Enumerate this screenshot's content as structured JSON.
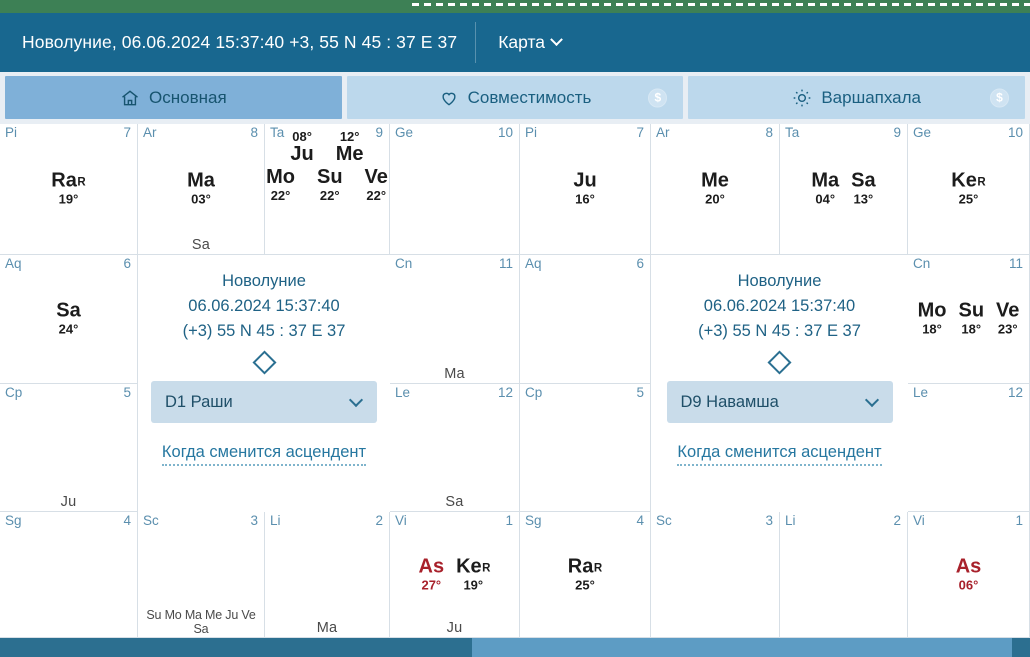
{
  "header": {
    "title": "Новолуние, 06.06.2024 15:37:40 +3, 55 N 45 : 37 E 37",
    "menu_label": "Карта",
    "chevron_icon": "chevron-down-icon",
    "bg": "#18678f"
  },
  "tabs": [
    {
      "label": "Основная",
      "icon": "home-icon",
      "active": true,
      "badge": ""
    },
    {
      "label": "Совместимость",
      "icon": "heart-icon",
      "active": false,
      "badge": "$"
    },
    {
      "label": "Варшапхала",
      "icon": "sun-icon",
      "active": false,
      "badge": "$"
    }
  ],
  "center_panels": {
    "left": {
      "title": "Новолуние",
      "datetime": "06.06.2024 15:37:40",
      "location": "(+3) 55 N 45 : 37 E 37",
      "diamond_icon": "diamond-icon",
      "select_value": "D1 Раши",
      "select_chevron_icon": "chevron-down-icon",
      "link_label": "Когда сменится асцендент"
    },
    "right": {
      "title": "Новолуние",
      "datetime": "06.06.2024 15:37:40",
      "location": "(+3) 55 N 45 : 37 E 37",
      "diamond_icon": "diamond-icon",
      "select_value": "D9 Навамша",
      "select_chevron_icon": "chevron-down-icon",
      "link_label": "Когда сменится асцендент"
    }
  },
  "chart_left": {
    "name": "D1 Раши",
    "cells": [
      {
        "sign": "Pi",
        "house": "7",
        "lord": "",
        "planets": [
          {
            "name": "Ra",
            "deg": "19°",
            "retro": "R",
            "asc": false
          }
        ]
      },
      {
        "sign": "Ar",
        "house": "8",
        "lord": "Sa",
        "planets": [
          {
            "name": "Ma",
            "deg": "03°",
            "retro": "",
            "asc": false
          }
        ]
      },
      {
        "sign": "Ta",
        "house": "9",
        "lord": "",
        "rows": [
          [
            {
              "name": "Ju",
              "deg": "08°",
              "degtop": true,
              "retro": "",
              "asc": false
            },
            {
              "name": "Me",
              "deg": "12°",
              "degtop": true,
              "retro": "",
              "asc": false
            }
          ],
          [
            {
              "name": "Mo",
              "deg": "22°",
              "retro": "",
              "asc": false
            },
            {
              "name": "Su",
              "deg": "22°",
              "retro": "",
              "asc": false
            },
            {
              "name": "Ve",
              "deg": "22°",
              "retro": "",
              "asc": false
            }
          ]
        ]
      },
      {
        "sign": "Ge",
        "house": "10",
        "lord": "",
        "planets": []
      },
      {
        "sign": "Aq",
        "house": "6",
        "lord": "",
        "planets": [
          {
            "name": "Sa",
            "deg": "24°",
            "retro": "",
            "asc": false
          }
        ]
      },
      {
        "sign": "Cn",
        "house": "11",
        "lord": "Ma",
        "planets": []
      },
      {
        "sign": "Cp",
        "house": "5",
        "lord": "Ju",
        "planets": []
      },
      {
        "sign": "Le",
        "house": "12",
        "lord": "Sa",
        "planets": []
      },
      {
        "sign": "Sg",
        "house": "4",
        "lord": "",
        "planets": []
      },
      {
        "sign": "Sc",
        "house": "3",
        "lord": "Su Mo Ma Me Ju Ve Sa",
        "lord_tight": true,
        "planets": []
      },
      {
        "sign": "Li",
        "house": "2",
        "lord": "Ma",
        "planets": []
      },
      {
        "sign": "Vi",
        "house": "1",
        "lord": "Ju",
        "planets": [
          {
            "name": "As",
            "deg": "27°",
            "retro": "",
            "asc": true
          },
          {
            "name": "Ke",
            "deg": "19°",
            "retro": "R",
            "asc": false
          }
        ]
      }
    ]
  },
  "chart_right": {
    "name": "D9 Навамша",
    "cells": [
      {
        "sign": "Pi",
        "house": "7",
        "lord": "",
        "planets": [
          {
            "name": "Ju",
            "deg": "16°",
            "retro": "",
            "asc": false
          }
        ]
      },
      {
        "sign": "Ar",
        "house": "8",
        "lord": "",
        "planets": [
          {
            "name": "Me",
            "deg": "20°",
            "retro": "",
            "asc": false
          }
        ]
      },
      {
        "sign": "Ta",
        "house": "9",
        "lord": "",
        "planets": [
          {
            "name": "Ma",
            "deg": "04°",
            "retro": "",
            "asc": false
          },
          {
            "name": "Sa",
            "deg": "13°",
            "retro": "",
            "asc": false
          }
        ]
      },
      {
        "sign": "Ge",
        "house": "10",
        "lord": "",
        "planets": [
          {
            "name": "Ke",
            "deg": "25°",
            "retro": "R",
            "asc": false
          }
        ]
      },
      {
        "sign": "Aq",
        "house": "6",
        "lord": "",
        "planets": []
      },
      {
        "sign": "Cn",
        "house": "11",
        "lord": "",
        "planets": [
          {
            "name": "Mo",
            "deg": "18°",
            "retro": "",
            "asc": false
          },
          {
            "name": "Su",
            "deg": "18°",
            "retro": "",
            "asc": false
          },
          {
            "name": "Ve",
            "deg": "23°",
            "retro": "",
            "asc": false
          }
        ]
      },
      {
        "sign": "Cp",
        "house": "5",
        "lord": "",
        "planets": []
      },
      {
        "sign": "Le",
        "house": "12",
        "lord": "",
        "planets": []
      },
      {
        "sign": "Sg",
        "house": "4",
        "lord": "",
        "planets": [
          {
            "name": "Ra",
            "deg": "25°",
            "retro": "R",
            "asc": false
          }
        ]
      },
      {
        "sign": "Sc",
        "house": "3",
        "lord": "",
        "planets": []
      },
      {
        "sign": "Li",
        "house": "2",
        "lord": "",
        "planets": []
      },
      {
        "sign": "Vi",
        "house": "1",
        "lord": "",
        "planets": [
          {
            "name": "As",
            "deg": "06°",
            "retro": "",
            "asc": true
          }
        ]
      }
    ]
  },
  "colors": {
    "header_bg": "#18678f",
    "green_strip": "#3d8055",
    "tab_active": "#7fb0d8",
    "tab_inactive": "#bcd8ec",
    "ascendant_red": "#a8212b",
    "sign_label": "#5b8fae",
    "scrollbar_thumb": "#2c6f90"
  }
}
